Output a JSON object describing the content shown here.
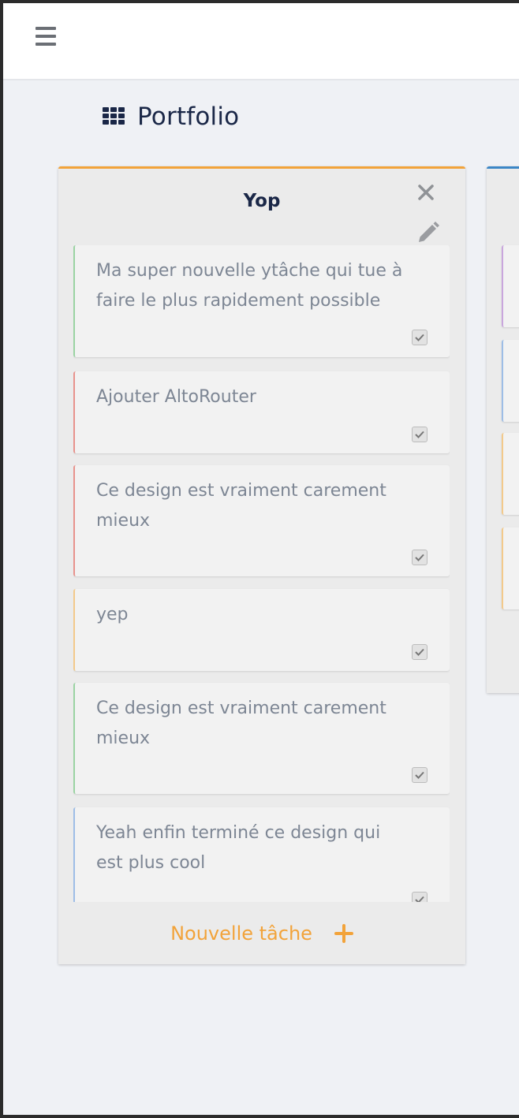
{
  "header": {
    "menu_icon": "hamburger-menu-icon",
    "page_icon": "grid-icon",
    "page_title": "Portfolio"
  },
  "board": {
    "title": "Yop",
    "accent_color": "#f2a33a",
    "close_icon": "close-icon",
    "edit_icon": "pencil-icon",
    "tasks": [
      {
        "text": "Ma super nouvelle ytâche qui tue à faire le plus rapidement possible",
        "color": "#9ad3a2",
        "done": true
      },
      {
        "text": "Ajouter AltoRouter",
        "color": "#e8928c",
        "done": true
      },
      {
        "text": "Ce design est vraiment carement mieux",
        "color": "#e8928c",
        "done": true
      },
      {
        "text": "yep",
        "color": "#f3c98a",
        "done": true
      },
      {
        "text": "Ce design est vraiment carement mieux",
        "color": "#9ad3a2",
        "done": true
      },
      {
        "text": "Yeah enfin terminé ce design qui est plus cool",
        "color": "#9dbde6",
        "done": true
      }
    ],
    "new_task_label": "Nouvelle tâche",
    "new_task_icon": "plus-icon"
  },
  "next_board": {
    "accent_color": "#3b86c6",
    "task_colors": [
      "#c9a6dd",
      "#9dbde6",
      "#f3c98a",
      "#f3c98a"
    ]
  }
}
